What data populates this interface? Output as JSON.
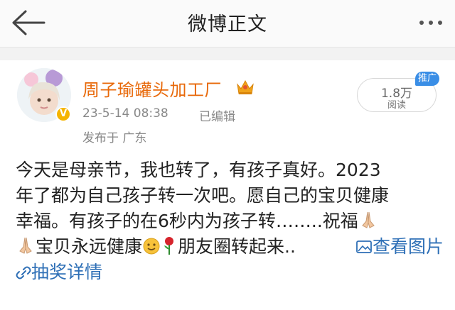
{
  "header": {
    "title": "微博正文",
    "back_icon": "arrow-left-icon",
    "more_icon": "more-dots-icon"
  },
  "post": {
    "author": "周子瑜罐头加工厂",
    "avatar_badge_icon": "verified-v-icon",
    "member_icon": "crown-icon",
    "time": "23-5-14 08:38",
    "edited": "已编辑",
    "location": "发布于 广东",
    "views": {
      "count": "1.8万",
      "label": "阅读"
    },
    "promo_badge": "推广",
    "text_lines": [
      "今天是母亲节，我也转了，有孩子真好。2023",
      "年了都为自己孩子转一次吧。愿自己的宝贝健康",
      "幸福。有孩子的在6秒内为孩子转……..祝福"
    ],
    "line4_a": "宝贝永远健康",
    "line4_b": "朋友圈转起来..",
    "view_pictures": "查看图片",
    "lottery": "抽奖详情",
    "colors": {
      "author": "#e8690a",
      "link": "#2e6fb6",
      "meta": "#888888"
    }
  }
}
